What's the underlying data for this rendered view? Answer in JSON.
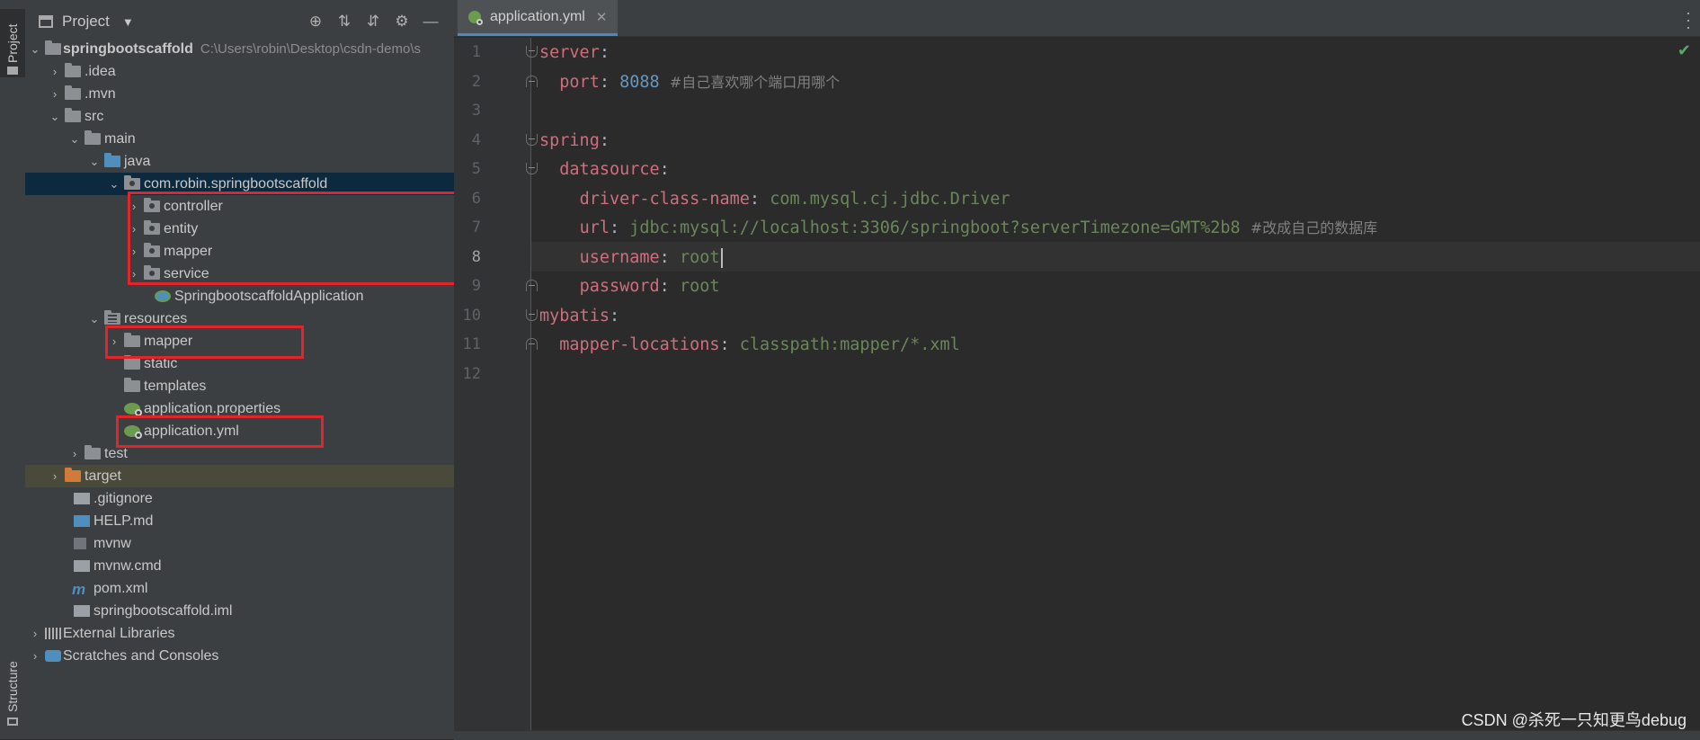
{
  "left_strip": {
    "project_tab": "Project",
    "structure_tab": "Structure"
  },
  "project_panel": {
    "title": "Project",
    "tools": [
      "locate-icon",
      "expand-all-icon",
      "collapse-all-icon",
      "gear-icon",
      "minimize-icon"
    ],
    "root_name": "springbootscaffold",
    "root_path": "C:\\Users\\robin\\Desktop\\csdn-demo\\s",
    "items": {
      "idea": ".idea",
      "mvn": ".mvn",
      "src": "src",
      "main": "main",
      "java": "java",
      "package": "com.robin.springbootscaffold",
      "controller": "controller",
      "entity": "entity",
      "mapper": "mapper",
      "service": "service",
      "app_class": "SpringbootscaffoldApplication",
      "resources": "resources",
      "res_mapper": "mapper",
      "static": "static",
      "templates": "templates",
      "app_properties": "application.properties",
      "app_yml": "application.yml",
      "test": "test",
      "target": "target",
      "gitignore": ".gitignore",
      "help": "HELP.md",
      "mvnw": "mvnw",
      "mvnw_cmd": "mvnw.cmd",
      "pom": "pom.xml",
      "iml": "springbootscaffold.iml",
      "ext_libs": "External Libraries",
      "scratches": "Scratches and Consoles"
    }
  },
  "editor": {
    "tab_label": "application.yml",
    "line_numbers": [
      "1",
      "2",
      "3",
      "4",
      "5",
      "6",
      "7",
      "8",
      "9",
      "10",
      "11",
      "12"
    ],
    "current_line": 8,
    "code": {
      "l1_key": "server",
      "l2_key": "port",
      "l2_val": "8088",
      "l2_comment": "#自己喜欢哪个端口用哪个",
      "l4_key": "spring",
      "l5_key": "datasource",
      "l6_key": "driver-class-name",
      "l6_val": "com.mysql.cj.jdbc.Driver",
      "l7_key": "url",
      "l7_val": "jdbc:mysql://localhost:3306/springboot?serverTimezone=GMT%2b8",
      "l7_comment": "#改成自己的数据库",
      "l8_key": "username",
      "l8_val": "root",
      "l9_key": "password",
      "l9_val": "root",
      "l10_key": "mybatis",
      "l11_key": "mapper-locations",
      "l11_val": "classpath:mapper/*.xml"
    }
  },
  "watermark": "CSDN @杀死一只知更鸟debug",
  "colors": {
    "highlight_box": "#e3242b",
    "key": "#cf6e7e",
    "number": "#6897bb",
    "string": "#6a8759",
    "comment": "#808080"
  }
}
